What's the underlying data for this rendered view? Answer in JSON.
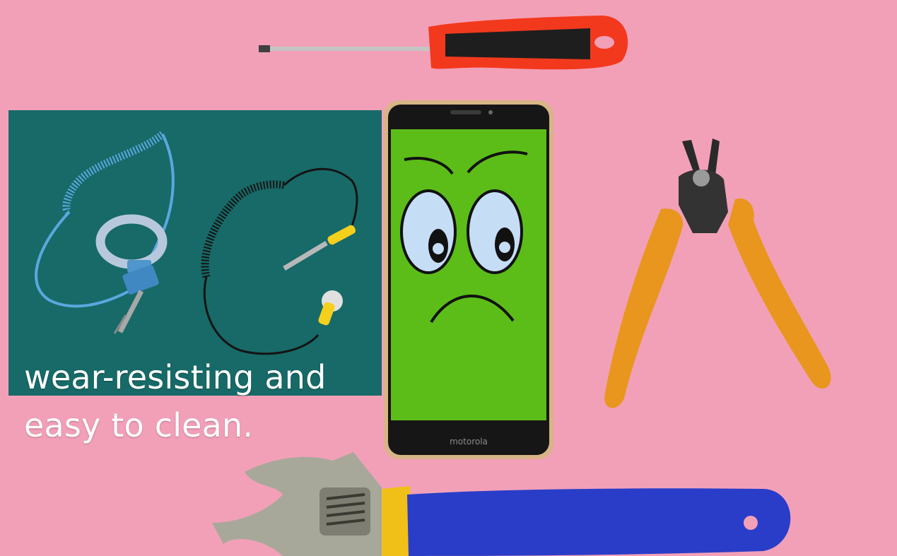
{
  "caption": {
    "line1": "wear-resisting and",
    "line2": "easy to clean."
  },
  "phone": {
    "brand": "motorola"
  },
  "colors": {
    "background": "#f2a0b8",
    "mat": "#176a68",
    "screen": "#5cbd18",
    "screwdriver_handle": "#f2391d",
    "pliers_handle": "#e8961e",
    "wrench_handle": "#2a3dc8",
    "wrench_collar": "#f0c018",
    "cord_blue": "#5aa8de",
    "cord_black": "#141414",
    "clip_yellow": "#f4cf1c"
  }
}
